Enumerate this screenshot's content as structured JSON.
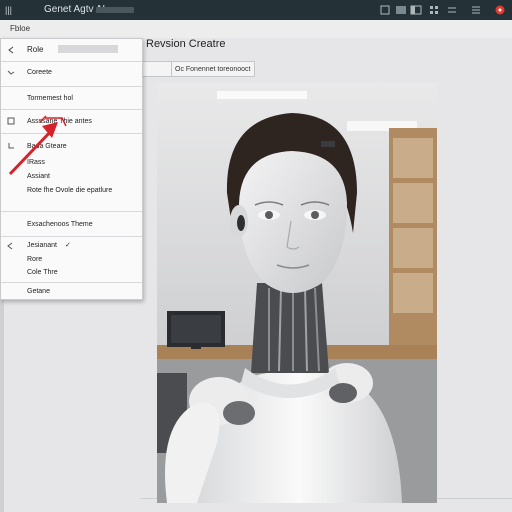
{
  "window": {
    "title": "Genet Agtv AI"
  },
  "tab": {
    "label": "Fbloe"
  },
  "page": {
    "title": "Revsion Creatre"
  },
  "breadcrumb": {
    "left": "",
    "right": "Oc Fonennet toreonooct"
  },
  "dropdown": {
    "role_label": "Role",
    "items": [
      {
        "label": "Coreete"
      },
      {
        "label": "Tormemest hol"
      },
      {
        "label": "Assssane Thie antes"
      },
      {
        "label": "Bada Gteare"
      },
      {
        "label": "IRass"
      },
      {
        "label": "Assiant"
      },
      {
        "label": "Rote fhe Ovole die epatlure"
      },
      {
        "label": "Exsachenoos Theme"
      },
      {
        "label": "Jesianant"
      },
      {
        "label": "Rore"
      },
      {
        "label": "Cole Thre"
      },
      {
        "label": "Getane"
      }
    ]
  },
  "colors": {
    "topbar": "#243238",
    "accent_arrow": "#d6222b",
    "red_icon": "#e23a2f"
  },
  "icons": [
    "grid-icon",
    "chevron-left-icon",
    "chevron-icon",
    "doc-icon",
    "back-icon",
    "check-icon",
    "arrow-annotation"
  ]
}
